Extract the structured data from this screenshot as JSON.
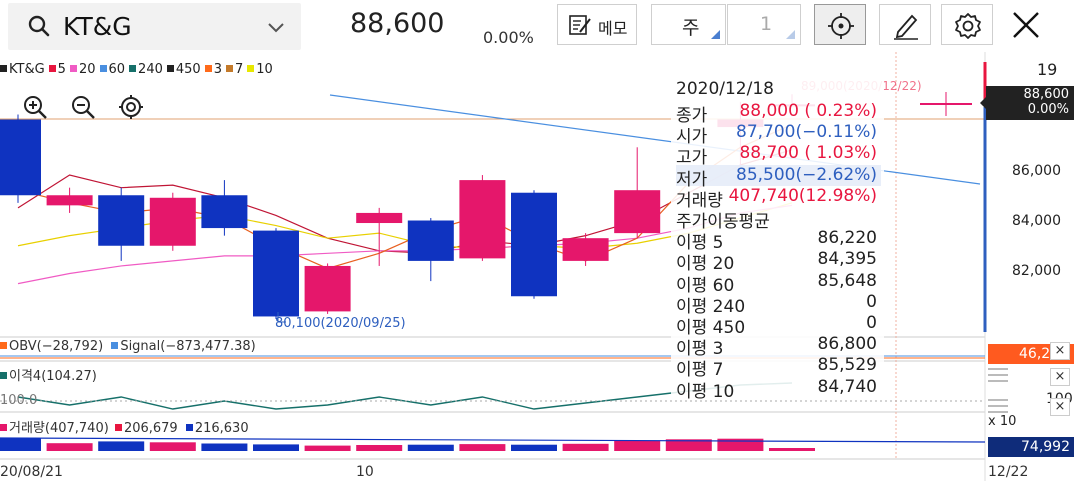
{
  "header": {
    "stock_name": "KT&G",
    "price": "88,600",
    "change_pct": "0.00%",
    "memo_label": "메모",
    "period_label": "주",
    "period_number": "1"
  },
  "legend": {
    "items": [
      {
        "label": "KT&G",
        "color": "#222222"
      },
      {
        "label": "5",
        "color": "#e8163f"
      },
      {
        "label": "20",
        "color": "#f05bc4"
      },
      {
        "label": "60",
        "color": "#4a8fe0"
      },
      {
        "label": "240",
        "color": "#16706a"
      },
      {
        "label": "450",
        "color": "#222222"
      },
      {
        "label": "3",
        "color": "#ff6a1a"
      },
      {
        "label": "7",
        "color": "#c47a2a"
      },
      {
        "label": "10",
        "color": "#e8e800"
      }
    ]
  },
  "y_axis": {
    "top_label": "19",
    "ticks": [
      "86,000",
      "84,000",
      "82,000"
    ],
    "price_tag_value": "88,600",
    "price_tag_pct": "0.00%",
    "obv_value": "46,200",
    "disparity_tick": "100",
    "vol_multiplier": "x 10",
    "vol_value": "74,992"
  },
  "annotations": {
    "high_mark": "89,000(2020/12/22)",
    "low_mark": "80,100(2020/09/25)"
  },
  "subcharts": {
    "obv_label": "OBV(−28,792)",
    "signal_label": "Signal(−873,477.38)",
    "disparity_label": "이격4(104.27)",
    "disparity_base": "100.0",
    "volume_label": "거래량(407,740)",
    "vol_ma1": "206,679",
    "vol_ma2": "216,630"
  },
  "x_axis": {
    "labels": [
      "20/08/21",
      "10",
      "12/22"
    ]
  },
  "popup": {
    "date": "2020/12/18",
    "rows": [
      {
        "key": "종가",
        "value": "88,000 ( 0.23%)",
        "color": "red"
      },
      {
        "key": "시가",
        "value": "87,700(−0.11%)",
        "color": "blue"
      },
      {
        "key": "고가",
        "value": "88,700 ( 1.03%)",
        "color": "red"
      },
      {
        "key": "저가",
        "value": "85,500(−2.62%)",
        "color": "blue"
      },
      {
        "key": "거래량",
        "value": "407,740(12.98%)",
        "color": "red"
      }
    ],
    "ma_title": "주가이동평균",
    "ma_rows": [
      {
        "key": "이평 5",
        "value": "86,220"
      },
      {
        "key": "이평 20",
        "value": "84,395"
      },
      {
        "key": "이평 60",
        "value": "85,648"
      },
      {
        "key": "이평 240",
        "value": "0"
      },
      {
        "key": "이평 450",
        "value": "0"
      },
      {
        "key": "이평 3",
        "value": "86,800"
      },
      {
        "key": "이평 7",
        "value": "85,529"
      },
      {
        "key": "이평 10",
        "value": "84,740"
      }
    ]
  },
  "chart_data": {
    "type": "candlestick",
    "up_color": "#e5176b",
    "down_color": "#0f33c0",
    "y_range": [
      80000,
      89000
    ],
    "candles": [
      {
        "open": 88000,
        "close": 85000,
        "high": 88200,
        "low": 84700
      },
      {
        "open": 84600,
        "close": 85000,
        "high": 85300,
        "low": 84300
      },
      {
        "open": 85000,
        "close": 83000,
        "high": 85300,
        "low": 82400
      },
      {
        "open": 83000,
        "close": 84900,
        "high": 85100,
        "low": 82800
      },
      {
        "open": 85000,
        "close": 83700,
        "high": 85600,
        "low": 83400
      },
      {
        "open": 83600,
        "close": 80200,
        "high": 83700,
        "low": 80100
      },
      {
        "open": 80400,
        "close": 82200,
        "high": 82300,
        "low": 80300
      },
      {
        "open": 83900,
        "close": 84300,
        "high": 84500,
        "low": 82200
      },
      {
        "open": 84000,
        "close": 82400,
        "high": 84100,
        "low": 81600
      },
      {
        "open": 82500,
        "close": 85600,
        "high": 85800,
        "low": 82400
      },
      {
        "open": 85100,
        "close": 81000,
        "high": 85200,
        "low": 80900
      },
      {
        "open": 82400,
        "close": 83300,
        "high": 83500,
        "low": 82200
      },
      {
        "open": 83500,
        "close": 85200,
        "high": 86900,
        "low": 83300
      },
      {
        "open": 85500,
        "close": 88000,
        "high": 88700,
        "low": 85500
      },
      {
        "open": 87700,
        "close": 88000,
        "high": 88700,
        "low": 85500
      },
      {
        "open": 88600,
        "close": 88600,
        "high": 89000,
        "low": 88600
      }
    ],
    "volume": [
      4.2,
      2.6,
      3.2,
      2.9,
      2.5,
      2.2,
      1.8,
      2.0,
      2.1,
      2.3,
      2.1,
      2.4,
      3.4,
      3.9,
      4.1,
      1.0
    ],
    "disparity": [
      101,
      99,
      101,
      98,
      100,
      98,
      99,
      101,
      99,
      101,
      98,
      99.5,
      101,
      102.5,
      104,
      104.5
    ]
  }
}
